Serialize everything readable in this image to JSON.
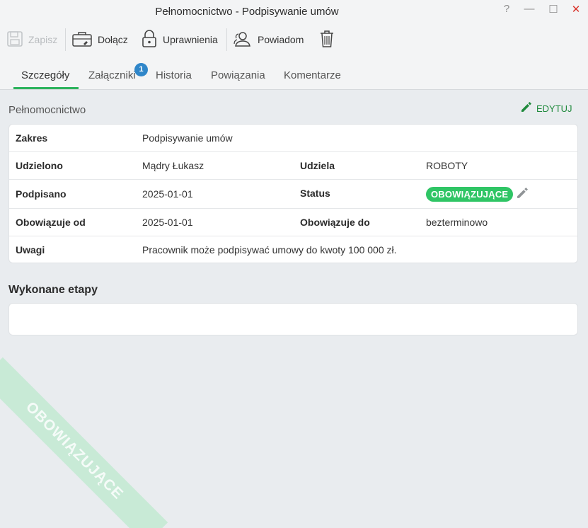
{
  "window": {
    "title": "Pełnomocnictwo - Podpisywanie umów",
    "help": "?",
    "minimize": "—",
    "maximize": "☐",
    "close": "✕"
  },
  "toolbar": {
    "save": "Zapisz",
    "attach": "Dołącz",
    "permissions": "Uprawnienia",
    "notify": "Powiadom"
  },
  "tabs": [
    {
      "label": "Szczegóły",
      "active": true
    },
    {
      "label": "Załączniki",
      "badge": "1"
    },
    {
      "label": "Historia"
    },
    {
      "label": "Powiązania"
    },
    {
      "label": "Komentarze"
    }
  ],
  "section": {
    "title": "Pełnomocnictwo",
    "edit": "EDYTUJ"
  },
  "details": {
    "zakres_label": "Zakres",
    "zakres_value": "Podpisywanie umów",
    "udzielono_label": "Udzielono",
    "udzielono_value": "Mądry Łukasz",
    "udziela_label": "Udziela",
    "udziela_value": "ROBOTY",
    "podpisano_label": "Podpisano",
    "podpisano_value": "2025-01-01",
    "status_label": "Status",
    "status_value": "OBOWIĄZUJĄCE",
    "od_label": "Obowiązuje od",
    "od_value": "2025-01-01",
    "do_label": "Obowiązuje do",
    "do_value": "bezterminowo",
    "uwagi_label": "Uwagi",
    "uwagi_value": "Pracownik może podpisywać umowy do kwoty 100 000 zł."
  },
  "stages": {
    "title": "Wykonane etapy"
  },
  "watermark": "OBOWIĄZUJĄCE",
  "colors": {
    "accent": "#2db35d",
    "status": "#2fc565",
    "badge": "#2f86c9",
    "close": "#d9342b"
  }
}
